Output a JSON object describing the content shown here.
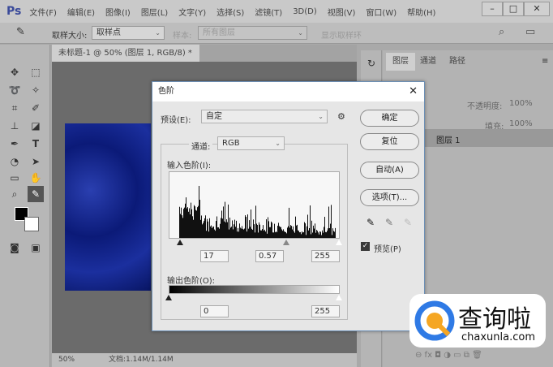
{
  "app": {
    "logo": "Ps",
    "menu": [
      "文件(F)",
      "编辑(E)",
      "图像(I)",
      "图层(L)",
      "文字(Y)",
      "选择(S)",
      "滤镜(T)",
      "3D(D)",
      "视图(V)",
      "窗口(W)",
      "帮助(H)"
    ],
    "window_buttons": [
      "–",
      "□",
      "✕"
    ]
  },
  "options": {
    "sample_size_label": "取样大小:",
    "sample_size_value": "取样点",
    "sample_label": "样本:",
    "sample_value": "所有图层",
    "show_ring": "显示取样环"
  },
  "document": {
    "tab_title": "未标题-1 @ 50% (图层 1, RGB/8) *",
    "close": "×",
    "zoom": "50%",
    "doc_info": "文档:1.14M/1.14M"
  },
  "layers_panel": {
    "tabs": [
      "图层",
      "通道",
      "路径"
    ],
    "opacity_label": "不透明度:",
    "opacity": "100%",
    "fill_label": "填充:",
    "fill": "100%",
    "layer_name": "图层 1"
  },
  "levels_dialog": {
    "title": "色阶",
    "close": "✕",
    "preset_label": "预设(E):",
    "preset_value": "自定",
    "channel_label": "通道:",
    "channel_value": "RGB",
    "input_label": "输入色阶(I):",
    "input_black": "17",
    "input_gamma": "0.57",
    "input_white": "255",
    "output_label": "输出色阶(O):",
    "output_black": "0",
    "output_white": "255",
    "buttons": {
      "ok": "确定",
      "reset": "复位",
      "auto": "自动(A)",
      "options": "选项(T)..."
    },
    "preview_label": "预览(P)",
    "preview_checked": true
  },
  "watermark": {
    "brand": "查询啦",
    "url": "chaxunla.com"
  }
}
